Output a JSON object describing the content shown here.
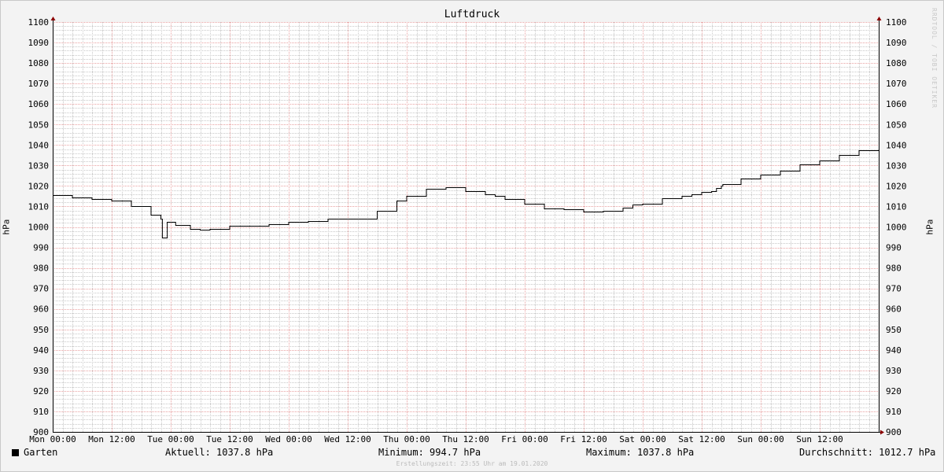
{
  "chart_data": {
    "type": "line",
    "title": "Luftdruck",
    "ylabel": "hPa",
    "ylim": [
      900,
      1100
    ],
    "y_ticks": [
      900,
      910,
      920,
      930,
      940,
      950,
      960,
      970,
      980,
      990,
      1000,
      1010,
      1020,
      1030,
      1040,
      1050,
      1060,
      1070,
      1080,
      1090,
      1100
    ],
    "x_ticks": [
      "Mon 00:00",
      "Mon 12:00",
      "Tue 00:00",
      "Tue 12:00",
      "Wed 00:00",
      "Wed 12:00",
      "Thu 00:00",
      "Thu 12:00",
      "Fri 00:00",
      "Fri 12:00",
      "Sat 00:00",
      "Sat 12:00",
      "Sun 00:00",
      "Sun 12:00"
    ],
    "x_unit": "hours since Mon 00:00",
    "xlim": [
      0,
      168
    ],
    "grid": true,
    "series": [
      {
        "name": "Garten",
        "color": "#000000",
        "x": [
          0,
          4,
          8,
          12,
          16,
          20,
          22,
          22.3,
          23,
          23.3,
          25,
          28,
          30,
          32,
          36,
          40,
          44,
          48,
          52,
          56,
          60,
          64,
          66,
          70,
          72,
          76,
          80,
          84,
          88,
          90,
          92,
          96,
          100,
          104,
          108,
          112,
          116,
          118,
          120,
          124,
          128,
          130,
          132,
          134,
          135,
          135.3,
          136,
          136.3,
          140,
          144,
          148,
          152,
          156,
          160,
          164,
          168
        ],
        "values": [
          1015.5,
          1014.5,
          1013.5,
          1013,
          1010,
          1006,
          1004,
          994.7,
          994.7,
          1002.5,
          1001,
          999,
          998.5,
          999,
          1000.5,
          1000.5,
          1001.5,
          1002.5,
          1003,
          1004,
          1004,
          1004,
          1008,
          1013,
          1015,
          1018.5,
          1019.5,
          1017.5,
          1016,
          1015,
          1013.5,
          1011.5,
          1009,
          1008.5,
          1007.5,
          1008,
          1009.5,
          1011,
          1011.5,
          1014,
          1015,
          1016,
          1017,
          1017.5,
          1019,
          1019,
          1020,
          1021,
          1023.5,
          1025.5,
          1027.5,
          1030.5,
          1032.5,
          1035,
          1037.5,
          1037.8
        ]
      }
    ],
    "stats": {
      "legend_name": "Garten",
      "current": "Aktuell: 1037.8 hPa",
      "minimum": "Minimum: 994.7 hPa",
      "maximum": "Maximum: 1037.8 hPa",
      "average": "Durchschnitt: 1012.7 hPa"
    }
  },
  "credit": "RRDTOOL / TOBI OETIKER",
  "footer": "Erstellungszeit: 23:55 Uhr am 19.01.2020",
  "colors": {
    "background": "#f3f3f3",
    "plot": "#ffffff",
    "grid_minor": "#c8c8c8",
    "grid_major": "#e8a0a0",
    "axis": "#000000",
    "arrow": "#8b0000"
  }
}
